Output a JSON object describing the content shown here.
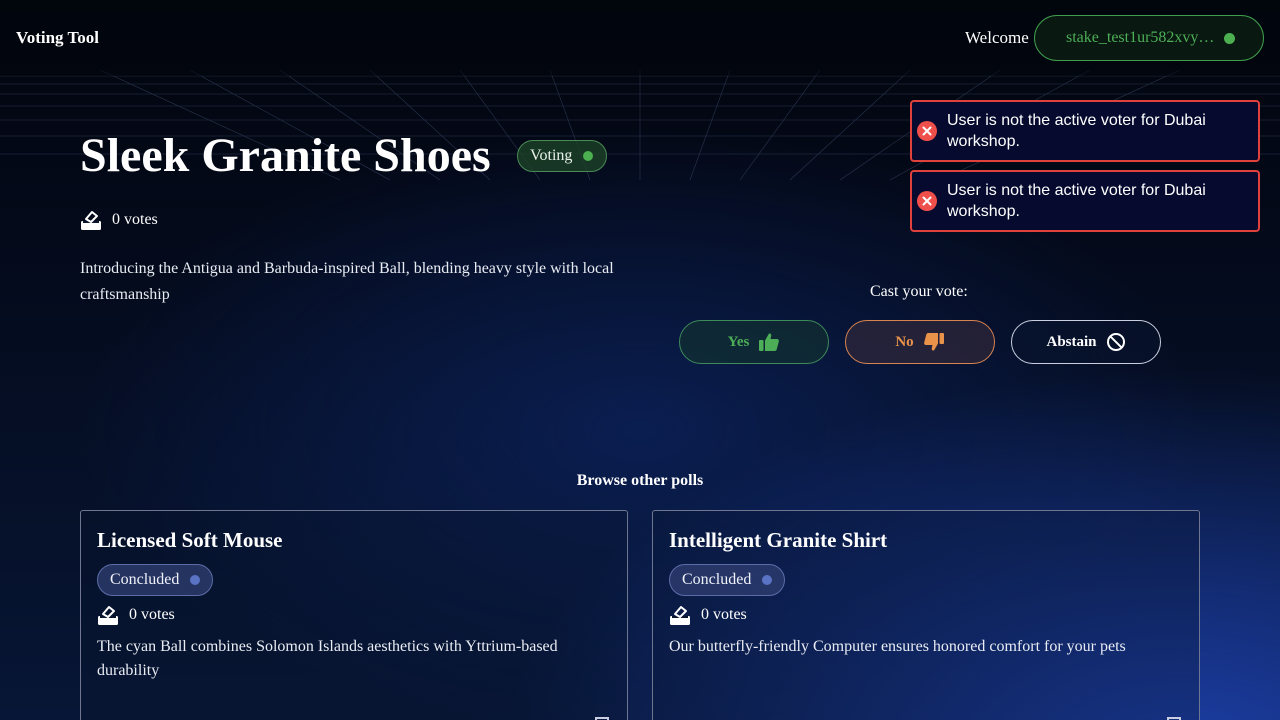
{
  "header": {
    "brand": "Voting Tool",
    "welcome": "Welcome",
    "wallet_address": "stake_test1ur582xvy…"
  },
  "poll": {
    "title": "Sleek Granite Shoes",
    "status": "Voting",
    "votes": "0 votes",
    "description": "Introducing the Antigua and Barbuda-inspired Ball, blending heavy style with local craftsmanship"
  },
  "toasts": [
    {
      "message": "User is not the active voter for Dubai workshop."
    },
    {
      "message": "User is not the active voter for Dubai workshop."
    }
  ],
  "voting": {
    "prompt": "Cast your vote:",
    "yes_label": "Yes",
    "no_label": "No",
    "abstain_label": "Abstain"
  },
  "browse": {
    "title": "Browse other polls",
    "cards": [
      {
        "title": "Licensed Soft Mouse",
        "status": "Concluded",
        "votes": "0 votes",
        "description": "The cyan Ball combines Solomon Islands aesthetics with Yttrium-based durability"
      },
      {
        "title": "Intelligent Granite Shirt",
        "status": "Concluded",
        "votes": "0 votes",
        "description": "Our butterfly-friendly Computer ensures honored comfort for your pets"
      }
    ]
  },
  "colors": {
    "accent_green": "#4cae56",
    "accent_orange": "#e89349",
    "error_red": "#e0413d",
    "concluded_dot": "#5b73c4"
  },
  "icons": {
    "wallet_status": "green-dot",
    "votes": "ballot-box-icon",
    "yes": "thumbs-up-icon",
    "no": "thumbs-down-icon",
    "abstain": "prohibited-icon",
    "toast": "error-x-icon"
  }
}
